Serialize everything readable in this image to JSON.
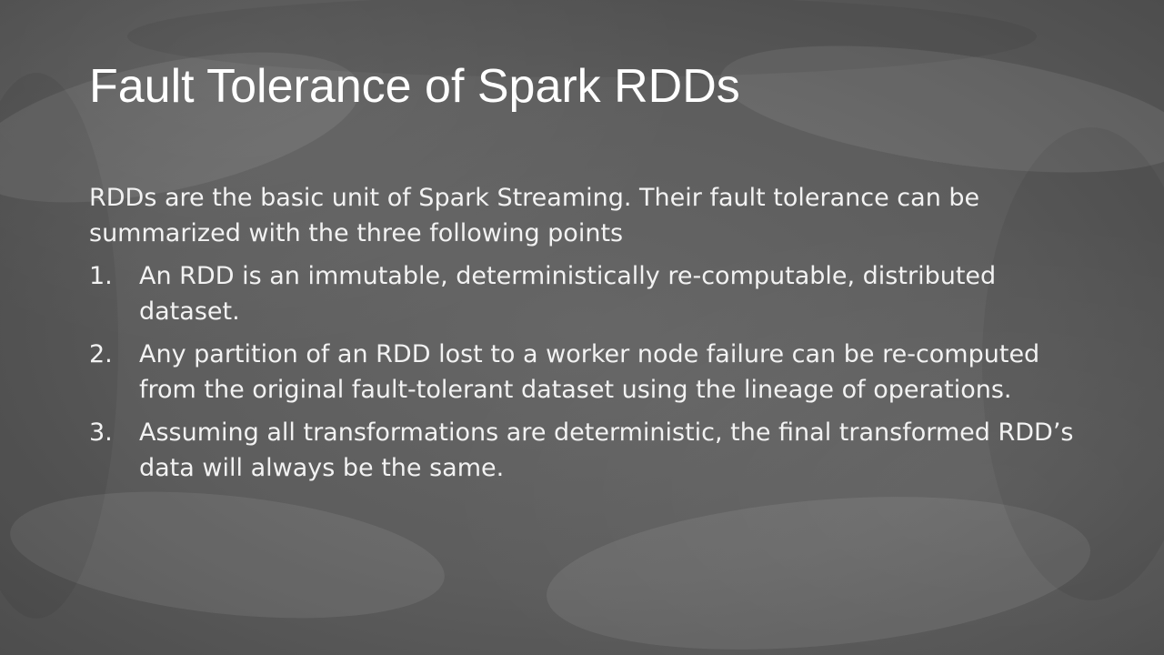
{
  "slide": {
    "title": "Fault Tolerance of Spark RDDs",
    "intro": "RDDs are the basic unit of Spark Streaming. Their fault tolerance can be summarized with the three following points",
    "points": [
      {
        "number": "1.",
        "text": "An RDD is an immutable, deterministically re-computable, distributed dataset."
      },
      {
        "number": "2.",
        "text": "Any partition of an RDD lost to a worker node failure can be re-computed from the original fault-tolerant dataset using the lineage of operations."
      },
      {
        "number": "3.",
        "text": "Assuming all transformations are deterministic, the final transformed RDD’s data will always be the same."
      }
    ],
    "background": "chalkboard-texture",
    "text_color": "#ffffff"
  }
}
